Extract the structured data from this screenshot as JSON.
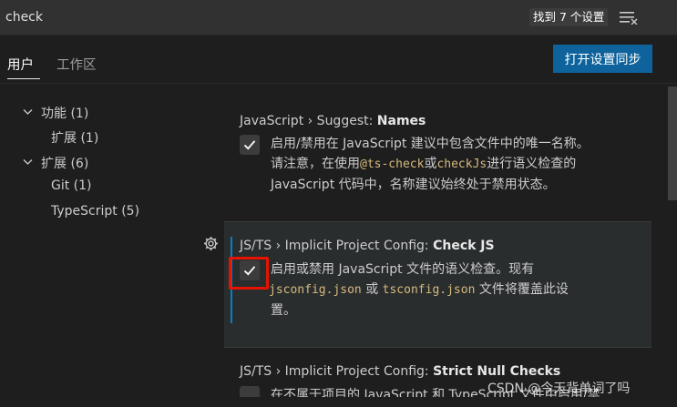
{
  "search": {
    "value": "check",
    "results_text": "找到 7 个设置"
  },
  "tabs": [
    {
      "label": "用户"
    },
    {
      "label": "工作区"
    }
  ],
  "sync_button": "打开设置同步",
  "toc": [
    {
      "label": "功能 (1)"
    },
    {
      "label": "扩展 (1)"
    },
    {
      "label": "扩展 (6)"
    },
    {
      "label": "Git (1)"
    },
    {
      "label": "TypeScript (5)"
    }
  ],
  "settings": [
    {
      "category": "JavaScript › Suggest: ",
      "name": "Names",
      "checked": true,
      "desc": {
        "line1": "启用/禁用在 JavaScript 建议中包含文件中的唯一名称。",
        "line2_pre": "请注意，在使用",
        "line2_code1": "@ts-check",
        "line2_mid": "或",
        "line2_code2": "checkJs",
        "line2_post": "进行语义检查的",
        "line3": "JavaScript 代码中，名称建议始终处于禁用状态。"
      }
    },
    {
      "category": "JS/TS › Implicit Project Config: ",
      "name": "Check JS",
      "checked": true,
      "desc": {
        "line1": "启用或禁用 JavaScript 文件的语义检查。现有",
        "line2_code1": "jsconfig.json",
        "line2_mid": " 或 ",
        "line2_code2": "tsconfig.json",
        "line2_post": " 文件将覆盖此设",
        "line3": "置。"
      }
    },
    {
      "category": "JS/TS › Implicit Project Config: ",
      "name": "Strict Null Checks",
      "checked": false,
      "desc": {
        "line1": "在不属于项目的 JavaScript 和 TypeScript 文件中启用/禁"
      }
    }
  ],
  "watermark": "CSDN @今天背单词了吗",
  "colors": {
    "accent": "#0e639c",
    "focus": "#007fd4",
    "highlight": "#e51400",
    "code": "#d7ba7d"
  }
}
